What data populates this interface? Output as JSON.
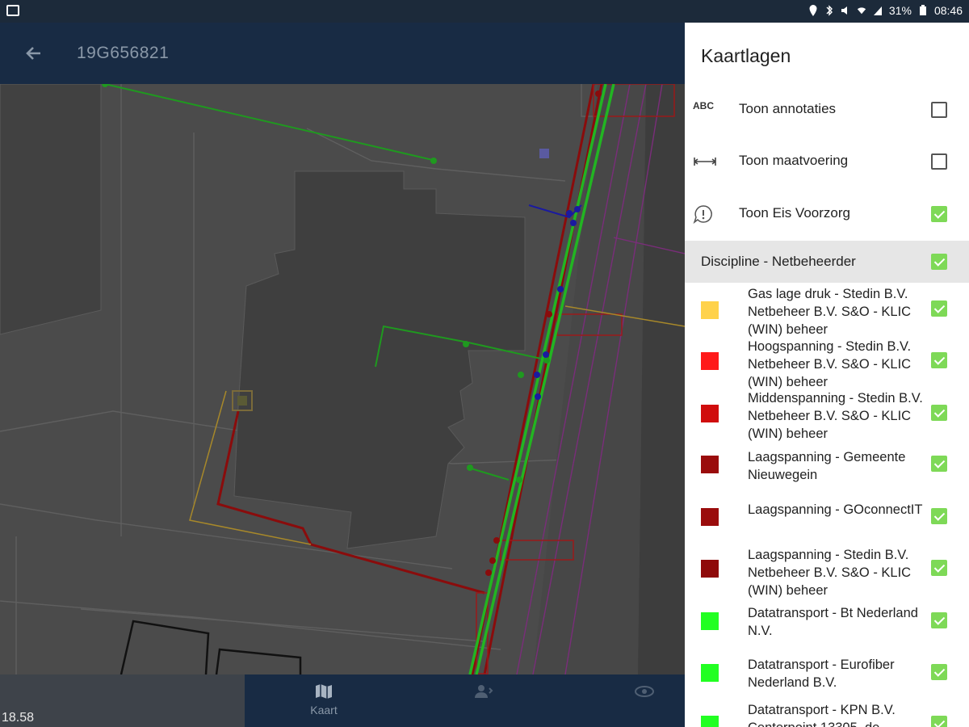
{
  "status_bar": {
    "battery": "31%",
    "time": "08:46"
  },
  "app_bar": {
    "title": "19G656821"
  },
  "map": {
    "scale_label": "18.58"
  },
  "bottom_nav": {
    "items": [
      {
        "label": "Kaart",
        "icon": "map-icon",
        "active": true
      },
      {
        "label": "",
        "icon": "contacts-icon",
        "active": false
      },
      {
        "label": "",
        "icon": "eye-icon",
        "active": false
      }
    ]
  },
  "panel": {
    "title": "Kaartlagen",
    "toggles": [
      {
        "icon_text": "ABC",
        "icon": "abc-icon",
        "label": "Toon annotaties",
        "checked": false
      },
      {
        "icon_text": "",
        "icon": "measure-icon",
        "label": "Toon maatvoering",
        "checked": false
      },
      {
        "icon_text": "",
        "icon": "warning-icon",
        "label": "Toon Eis Voorzorg",
        "checked": true
      }
    ],
    "section": {
      "label": "Discipline - Netbeheerder",
      "checked": true
    },
    "layers": [
      {
        "label": "Gas lage druk - Stedin B.V. Netbeheer B.V. S&O - KLIC (WIN) beheer",
        "color": "#ffd24a",
        "checked": true
      },
      {
        "label": "Hoogspanning - Stedin B.V. Netbeheer B.V. S&O - KLIC (WIN) beheer",
        "color": "#ff1a1a",
        "checked": true
      },
      {
        "label": "Middenspanning - Stedin B.V. Netbeheer B.V. S&O - KLIC (WIN) beheer",
        "color": "#d00d0d",
        "checked": true
      },
      {
        "label": "Laagspanning - Gemeente Nieuwegein",
        "color": "#9a0c0c",
        "checked": true
      },
      {
        "label": "Laagspanning - GOconnectIT",
        "color": "#9a0c0c",
        "checked": true
      },
      {
        "label": "Laagspanning - Stedin B.V. Netbeheer B.V. S&O - KLIC (WIN) beheer",
        "color": "#8f0a0a",
        "checked": true
      },
      {
        "label": "Datatransport - Bt Nederland N.V.",
        "color": "#22ff22",
        "checked": true
      },
      {
        "label": "Datatransport - Eurofiber Nederland B.V.",
        "color": "#22ff22",
        "checked": true
      },
      {
        "label": "Datatransport - KPN B.V. Centerpoint 13305, de",
        "color": "#22ff22",
        "checked": true
      }
    ]
  }
}
